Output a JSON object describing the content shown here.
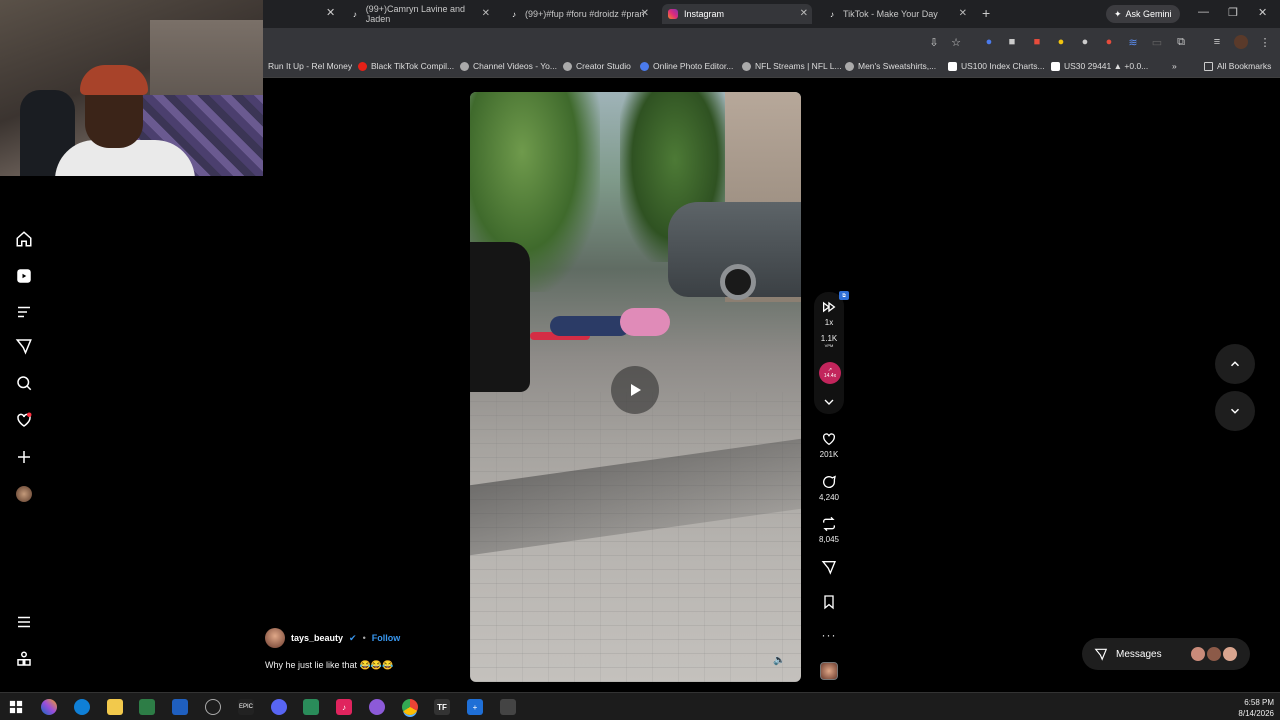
{
  "browser": {
    "tabs": [
      {
        "title": "(99+)Camryn Lavine and Jaden",
        "icon": "tiktok-icon"
      },
      {
        "title": "(99+)#fup #foru #droidz #pran",
        "icon": "tiktok-icon"
      },
      {
        "title": "Instagram",
        "icon": "instagram-icon",
        "active": true
      },
      {
        "title": "TikTok - Make Your Day",
        "icon": "tiktok-icon"
      }
    ],
    "ask_gemini": "Ask Gemini",
    "bookmarks": [
      "Run It Up - Rel Money",
      "Black TikTok Compil...",
      "Channel Videos - Yo...",
      "Creator Studio",
      "Online Photo Editor...",
      "NFL Streams | NFL L...",
      "Men's Sweatshirts,...",
      "US100 Index Charts...",
      "US30 29441 ▲ +0.0..."
    ],
    "all_bookmarks": "All Bookmarks"
  },
  "reel": {
    "author": "tays_beauty",
    "follow_label": "Follow",
    "caption": "Why he just lie like that 😂😂😂",
    "speed": "1x",
    "vpm": "1.1K",
    "vpm_label": "VPM",
    "trend_value": "14.4x",
    "likes": "201K",
    "comments": "4,240",
    "reposts": "8,045"
  },
  "messages": {
    "label": "Messages"
  },
  "taskbar": {
    "time": "6:58 PM",
    "date": "8/14/2026"
  },
  "colors": {
    "accent": "#3897f0",
    "trend": "#c2255c"
  }
}
